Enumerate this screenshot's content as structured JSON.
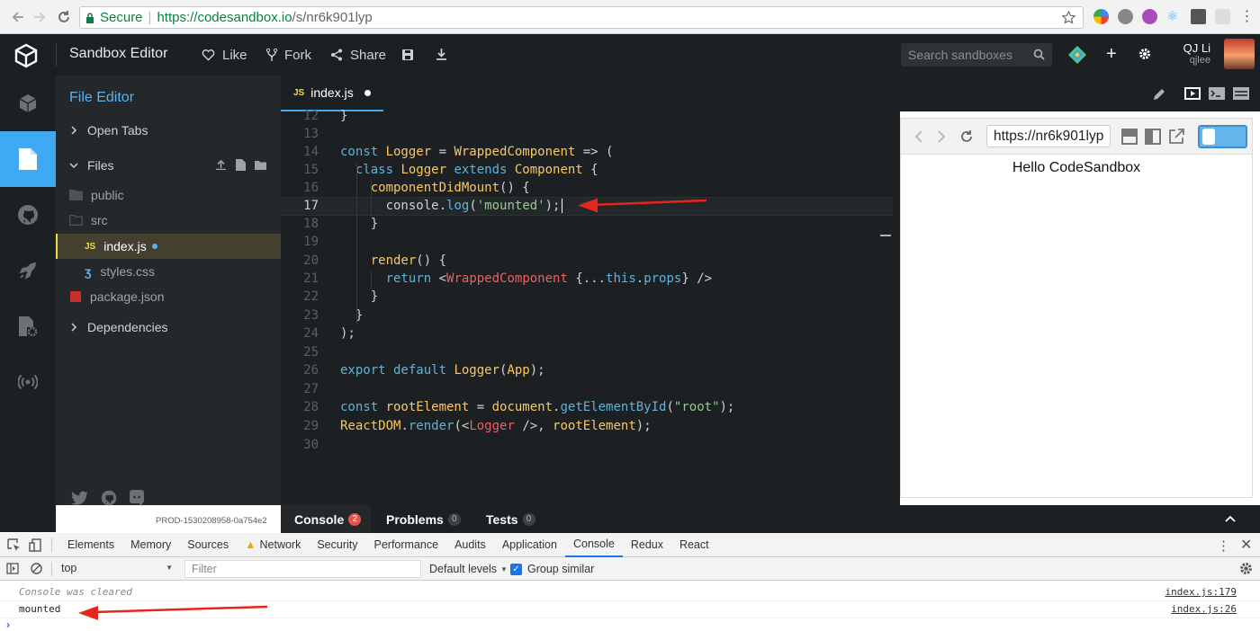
{
  "browser": {
    "secure_label": "Secure",
    "url_host": "https://codesandbox.io",
    "url_path": "/s/nr6k901lyp"
  },
  "header": {
    "title": "Sandbox Editor",
    "like": "Like",
    "fork": "Fork",
    "share": "Share",
    "search_placeholder": "Search sandboxes",
    "user_name": "QJ Li",
    "user_handle": "qjlee"
  },
  "sidebar": {
    "title": "File Editor",
    "open_tabs": "Open Tabs",
    "files": "Files",
    "items": [
      {
        "name": "public",
        "type": "folder"
      },
      {
        "name": "src",
        "type": "folder"
      },
      {
        "name": "index.js",
        "type": "js"
      },
      {
        "name": "styles.css",
        "type": "css"
      },
      {
        "name": "package.json",
        "type": "json"
      }
    ],
    "dependencies": "Dependencies",
    "build": "PROD-1530208958-0a754e2"
  },
  "editor": {
    "tab": "index.js",
    "lines": [
      {
        "n": "12",
        "t": "}"
      },
      {
        "n": "13",
        "t": ""
      },
      {
        "n": "14",
        "t": "const Logger = WrappedComponent => ("
      },
      {
        "n": "15",
        "t": "  class Logger extends Component {"
      },
      {
        "n": "16",
        "t": "    componentDidMount() {"
      },
      {
        "n": "17",
        "t": "      console.log('mounted');"
      },
      {
        "n": "18",
        "t": "    }"
      },
      {
        "n": "19",
        "t": ""
      },
      {
        "n": "20",
        "t": "    render() {"
      },
      {
        "n": "21",
        "t": "      return <WrappedComponent {...this.props} />"
      },
      {
        "n": "22",
        "t": "    }"
      },
      {
        "n": "23",
        "t": "  }"
      },
      {
        "n": "24",
        "t": ");"
      },
      {
        "n": "25",
        "t": ""
      },
      {
        "n": "26",
        "t": "export default Logger(App);"
      },
      {
        "n": "27",
        "t": ""
      },
      {
        "n": "28",
        "t": "const rootElement = document.getElementById(\"root\");"
      },
      {
        "n": "29",
        "t": "ReactDOM.render(<Logger />, rootElement);"
      },
      {
        "n": "30",
        "t": ""
      }
    ]
  },
  "preview": {
    "url": "https://nr6k901lyp",
    "content": "Hello CodeSandbox"
  },
  "bottom_tabs": [
    {
      "label": "Console",
      "count": "2"
    },
    {
      "label": "Problems",
      "count": "0"
    },
    {
      "label": "Tests",
      "count": "0"
    }
  ],
  "devtools": {
    "tabs": [
      "Elements",
      "Memory",
      "Sources",
      "Network",
      "Security",
      "Performance",
      "Audits",
      "Application",
      "Console",
      "Redux",
      "React"
    ],
    "context": "top",
    "filter_placeholder": "Filter",
    "levels": "Default levels",
    "group_similar": "Group similar",
    "messages": [
      {
        "text": "Console was cleared",
        "source": "index.js:179"
      },
      {
        "text": "mounted",
        "source": "index.js:26"
      }
    ]
  },
  "colors": {
    "accent": "#40a9f3",
    "arrow": "#e5261d"
  }
}
